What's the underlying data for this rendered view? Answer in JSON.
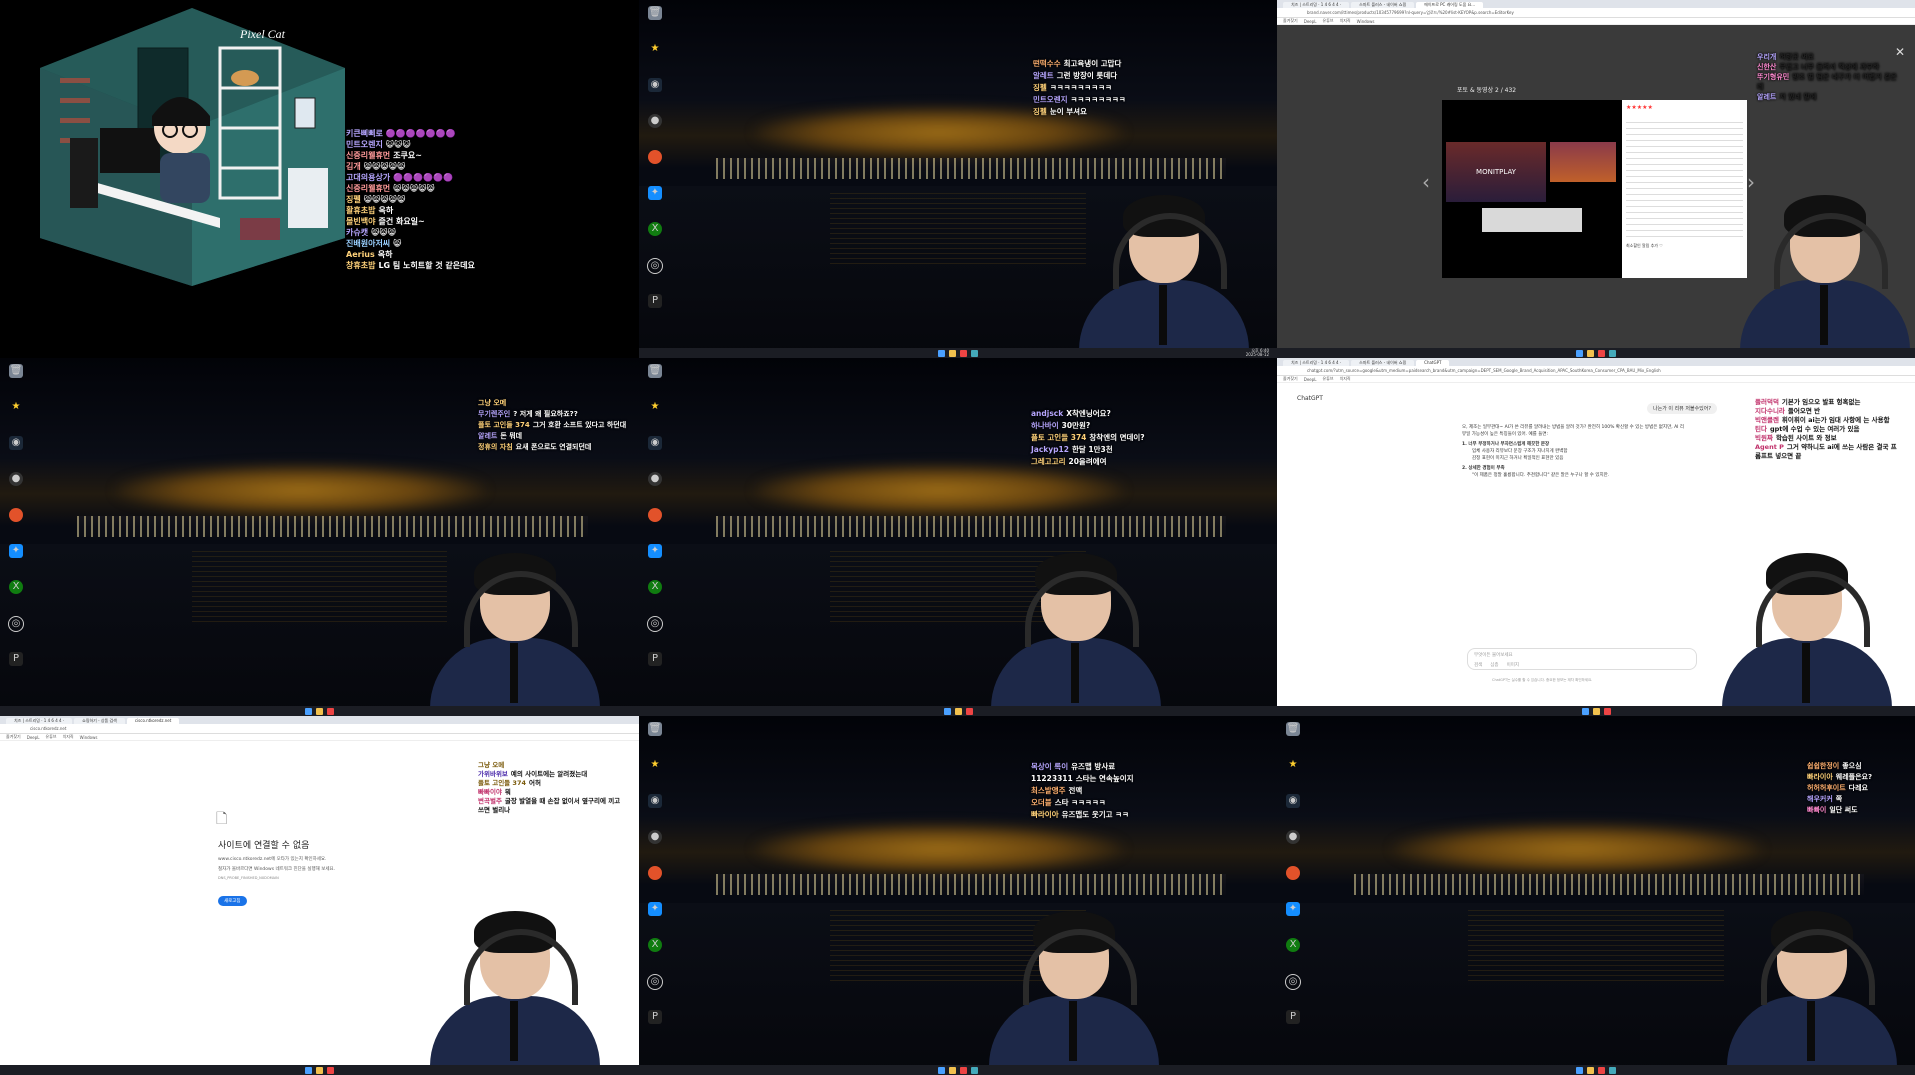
{
  "panels": {
    "p1": {
      "art_signature": "Pixel Cat",
      "chat": [
        {
          "user": "키큰삐삐로",
          "text": "🟣🟣🟣🟣🟣🟣🟣"
        },
        {
          "user": "민트오렌지",
          "text": "😺😺😺"
        },
        {
          "user": "신중리웰휴먼",
          "text": "조쿠요~"
        },
        {
          "user": "김개",
          "text": "😸😸😸😸😸"
        },
        {
          "user": "고대의용상가",
          "text": "🟣🟣🟣🟣🟣🟣"
        },
        {
          "user": "신중리웰휴먼",
          "text": "😸😸😸😸😸"
        },
        {
          "user": "징펠",
          "text": "😸😸😸😸😸"
        },
        {
          "user": "활휴초밥",
          "text": "옥하"
        },
        {
          "user": "몰빈백야",
          "text": "즐건 화요일~"
        },
        {
          "user": "카슈캣",
          "text": "😸😸😸"
        },
        {
          "user": "진배원아저씨",
          "text": "😸"
        },
        {
          "user": "Aerius",
          "text": "옥하"
        },
        {
          "user": "창휴초밥",
          "text": "LG 팀 노히트할 것 같은데요"
        }
      ]
    },
    "p2": {
      "chat": [
        {
          "user": "떤떡수수",
          "text": "최고육냉이 고맙다"
        },
        {
          "user": "알레트",
          "text": "그런 방장이 롯데다"
        },
        {
          "user": "징펠",
          "text": "ㅋㅋㅋㅋㅋㅋㅋㅋㅋ"
        },
        {
          "user": "민트오렌지",
          "text": "ㅋㅋㅋㅋㅋㅋㅋㅋ"
        },
        {
          "user": "징펠",
          "text": "눈이 부셔요"
        }
      ],
      "clock": {
        "time": "오후 6:40",
        "date": "2025-08-12"
      }
    },
    "p3": {
      "tabs": [
        "치즈 | 스트리밍 · 1 4 6 4 4 ·",
        "스마트 플러스 - 네이버 쇼핑",
        "에이프로 PC 캐어링 도움 요..."
      ],
      "address": "brand.naver.com/ittimes/products/10345779699?nl-query=업로드/%20#list-KEYOP&p.search=EditorKey",
      "bookmarks": [
        "즐겨찾기",
        "DeepL",
        "유튜브",
        "치지직",
        "Windows"
      ],
      "gallery_title": "포토 & 동영상",
      "gallery_count": "2 / 432",
      "video_brand": "MONITPLAY",
      "review_rating": "★★★★★",
      "review_footer": "최소할인 알림 추가 ♡",
      "chat": [
        {
          "user": "우리개",
          "text": "허향곳 써요"
        },
        {
          "user": "신한산",
          "text": "무겁고 너무 들려서 책상에 과부하"
        },
        {
          "user": "뚜기형유민",
          "text": "양조 벌 팀은 내구가 더 어렵거 같은데"
        },
        {
          "user": "알레트",
          "text": "저 있네 말에"
        }
      ]
    },
    "p4": {
      "chat": [
        {
          "user": "그냥 오메",
          "text": ""
        },
        {
          "user": "무기렌주인",
          "text": "? 저게 왜 필요하죠??"
        },
        {
          "user": "플토 고인들 374",
          "text": "그거 호환 소프트 있다고 하던대"
        },
        {
          "user": "알레트",
          "text": "돈 뭐데"
        },
        {
          "user": "정휴의 자침",
          "text": "요새 폰으로도 연결되던데"
        }
      ]
    },
    "p5": {
      "chat": [
        {
          "user": "andjsck",
          "text": "X착엔닝어요?"
        },
        {
          "user": "하나바이",
          "text": "30만원?"
        },
        {
          "user": "플토 고인들 374",
          "text": "창착엔의 면데이?"
        },
        {
          "user": "Jackyp12",
          "text": "한달 1만3천"
        },
        {
          "user": "그레고고리",
          "text": "20을려에여"
        }
      ]
    },
    "p6": {
      "tabs": [
        "치즈 | 스트리밍 · 1 4 6 4 4 ·",
        "스마트 플러스 - 네이버 쇼핑",
        "ChatGPT"
      ],
      "address": "chatgpt.com/?utm_source=google&utm_medium=paidsearch_brand&utm_campaign=DEPT_SEM_Google_Brand_Acquisition_APAC_SouthKorea_Consumer_CPA_BAU_Mix_English",
      "app_title": "ChatGPT",
      "user_msg": "나는가 이 리뷰 저볼수있어?",
      "answer_intro": "오, 제조는 일부관대~ AI가 쓴 리뷰를 알려내는 방법을 알려 것가? 완전히 100% 확신할 수 있는 방법은 없지만, AI 리뷰일 가능성이 높은 특징들이 있어. 예를 들면:",
      "points": [
        {
          "title": "1. 너무 부정하거나 부자연스럽게 깨끗한 문장",
          "bullets": [
            "입체 사용자 리뷰보다 문장 구조가 지나치게 완벽함",
            "감정 표현이 미지근 하거나 획일적인 표현만 있음"
          ]
        },
        {
          "title": "2. 상세한 경험이 부족",
          "bullets": [
            "\"이 제품은 정말 훌륭합니다. 추천합니다\" 같은 말은 누구나 할 수 있지만."
          ]
        }
      ],
      "input_placeholder": "무엇이든 물어보세요",
      "chips": [
        "검색",
        "심층",
        "이미지"
      ],
      "footer_note": "ChatGPT는 실수를 할 수 있습니다. 중요한 정보는 재차 확인하세요.",
      "chat": [
        {
          "user": "플러덕덕",
          "text": "기본가 임으오 발표 헝혹없는"
        },
        {
          "user": "지다수니라",
          "text": "들어오면 반"
        },
        {
          "user": "빅앤클렌",
          "text": "휘이휘이 ai는가 임대 사항에 는 사용함"
        },
        {
          "user": "틴다",
          "text": "gpt에 수업 수 있는 여러가 있음"
        },
        {
          "user": "빅원짜",
          "text": "학습된 사이트 와 정보"
        },
        {
          "user": "Agent P",
          "text": "그거 약하니도 ai에 쓰는 사람은 결국 프롬프트 넣으면 끝"
        }
      ]
    },
    "p7": {
      "tabs": [
        "치즈 | 스트리밍 · 1 4 6 4 4 ·",
        "쇼핑하기 - 상품 검색",
        "cisco.ntkoredz.net"
      ],
      "address": "cisco.ntkoredz.net",
      "bookmarks": [
        "즐겨찾기",
        "DeepL",
        "유튜브",
        "치지직",
        "Windows"
      ],
      "error_title": "사이트에 연결할 수 없음",
      "error_line1": "www.cisco.ntkoredz.net에 오타가 있는지 확인하세요.",
      "error_line2": "철자가 올바르다면 Windows 네트워크 진단을 실행해 보세요.",
      "error_code": "DNS_PROBE_FINISHED_NXDOMAIN",
      "reload_label": "새로고침",
      "chat": [
        {
          "user": "그냥 오메",
          "text": ""
        },
        {
          "user": "가위바위보",
          "text": "예의 사이트에는 알려졌는대"
        },
        {
          "user": "플토 고인들 374",
          "text": "어허"
        },
        {
          "user": "빠빠이야",
          "text": "뭐"
        },
        {
          "user": "변곡벌주",
          "text": "굴장 발열을 때 손잡 없이서 옆구리에 끼고 쓰면 벌리나"
        }
      ]
    },
    "p8": {
      "chat": [
        {
          "user": "목상이 록이",
          "text": "유즈맵 방사료"
        },
        {
          "user": "11223311",
          "text": "스타는 연속높이지"
        },
        {
          "user": "최스발앵주",
          "text": "전맥"
        },
        {
          "user": "오더블",
          "text": "스타 ㅋㅋㅋㅋㅋ"
        },
        {
          "user": "빠라이아",
          "text": "유즈맵도 웃기고 ㅋㅋ"
        }
      ]
    },
    "p9": {
      "chat": [
        {
          "user": "쉽쉽한정이",
          "text": "좋으심"
        },
        {
          "user": "빠라이아",
          "text": "웨레플은요?"
        },
        {
          "user": "허허허후이트",
          "text": "다레요"
        },
        {
          "user": "해우커커",
          "text": "쪽"
        },
        {
          "user": "빠빠이",
          "text": "일단 써도"
        }
      ]
    }
  },
  "desktop_icons": [
    "휴지통",
    "Brawlstars",
    "Steam",
    "OBS Studio",
    "Ableton",
    "Battle.net",
    "Xbox",
    "Riot Client",
    "PUBG"
  ],
  "colors": {
    "chat_user": "#b6a6ff",
    "chat_text": "#ffffff",
    "taskbar": "#1b1d24",
    "chrome_tab": "#dfe3ea"
  }
}
